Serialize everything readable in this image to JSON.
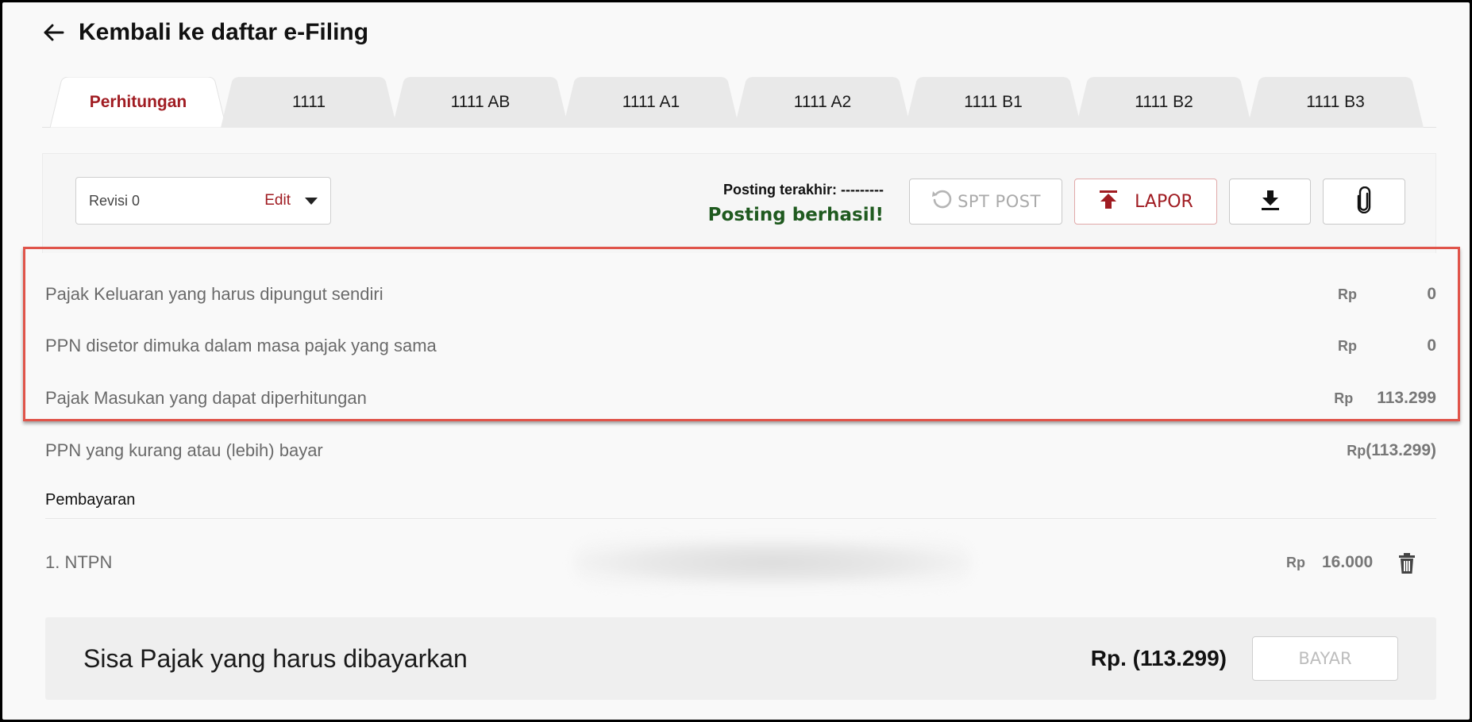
{
  "header": {
    "back_label": "Kembali ke daftar e-Filing"
  },
  "tabs": [
    {
      "label": "Perhitungan",
      "active": true
    },
    {
      "label": "1111",
      "active": false
    },
    {
      "label": "1111 AB",
      "active": false
    },
    {
      "label": "1111 A1",
      "active": false
    },
    {
      "label": "1111 A2",
      "active": false
    },
    {
      "label": "1111 B1",
      "active": false
    },
    {
      "label": "1111 B2",
      "active": false
    },
    {
      "label": "1111 B3",
      "active": false
    }
  ],
  "toolbar": {
    "revision_label": "Revisi 0",
    "edit_label": "Edit",
    "posting_last": "Posting terakhir: ---------",
    "posting_status": "Posting berhasil!",
    "spt_post_label": "SPT POST",
    "lapor_label": "LAPOR",
    "download_icon": "download-icon",
    "attach_icon": "paperclip-icon"
  },
  "summary_rows": [
    {
      "label": "Pajak Keluaran yang harus dipungut sendiri",
      "currency": "Rp",
      "value": "0"
    },
    {
      "label": "PPN disetor dimuka dalam masa pajak yang sama",
      "currency": "Rp",
      "value": "0"
    },
    {
      "label": "Pajak Masukan yang dapat diperhitungan",
      "currency": "Rp",
      "value": "113.299"
    },
    {
      "label": "PPN yang kurang atau (lebih) bayar",
      "currency": "Rp",
      "value": "(113.299)"
    }
  ],
  "payments": {
    "heading": "Pembayaran",
    "items": [
      {
        "label": "1. NTPN",
        "currency": "Rp",
        "value": "16.000"
      }
    ]
  },
  "balance": {
    "label": "Sisa Pajak yang harus dibayarkan",
    "total": "Rp. (113.299)",
    "pay_label": "BAYAR"
  },
  "colors": {
    "brand_red": "#a01c22",
    "success_green": "#1f5a1f",
    "highlight": "#e0544a"
  }
}
